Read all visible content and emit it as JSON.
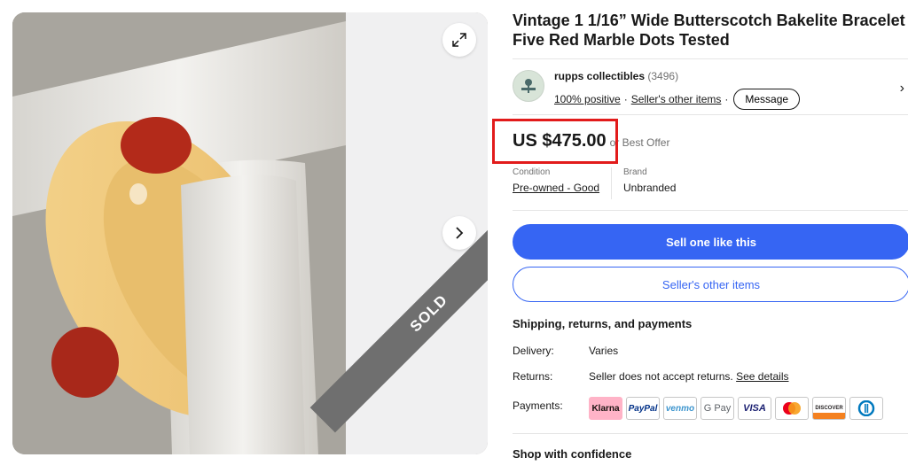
{
  "listing": {
    "title": "Vintage 1 1/16” Wide Butterscotch Bakelite Bracelet Five Red Marble Dots Tested",
    "sold_ribbon": "SOLD"
  },
  "seller": {
    "name": "rupps collectibles",
    "score": "(3496)",
    "positive": "100% positive",
    "other_items": "Seller's other items",
    "message_label": "Message"
  },
  "price": {
    "amount": "US $475.00",
    "best_offer": "or Best Offer",
    "highlight_color": "#e21b1b"
  },
  "specs": {
    "condition_label": "Condition",
    "condition_value": "Pre-owned - Good",
    "brand_label": "Brand",
    "brand_value": "Unbranded"
  },
  "actions": {
    "sell_one_like_this": "Sell one like this",
    "sellers_other_items": "Seller's other items"
  },
  "shipping": {
    "title": "Shipping, returns, and payments",
    "delivery_label": "Delivery:",
    "delivery_value": "Varies",
    "returns_label": "Returns:",
    "returns_value": "Seller does not accept returns.",
    "see_details": "See details",
    "payments_label": "Payments:",
    "payment_methods": [
      "Klarna",
      "PayPal",
      "venmo",
      "G Pay",
      "VISA",
      "Mastercard",
      "DISCOVER",
      "Diners Club"
    ]
  },
  "shop_confidence": "Shop with confidence",
  "colors": {
    "primary_blue": "#3665f3",
    "text": "#191919",
    "muted": "#707070",
    "bracelet": "#f0cf84",
    "dots": "#b32a1a"
  },
  "icons": {
    "expand": "expand-icon",
    "next": "chevron-right-icon",
    "seller_chevron": "chevron-right-icon"
  }
}
